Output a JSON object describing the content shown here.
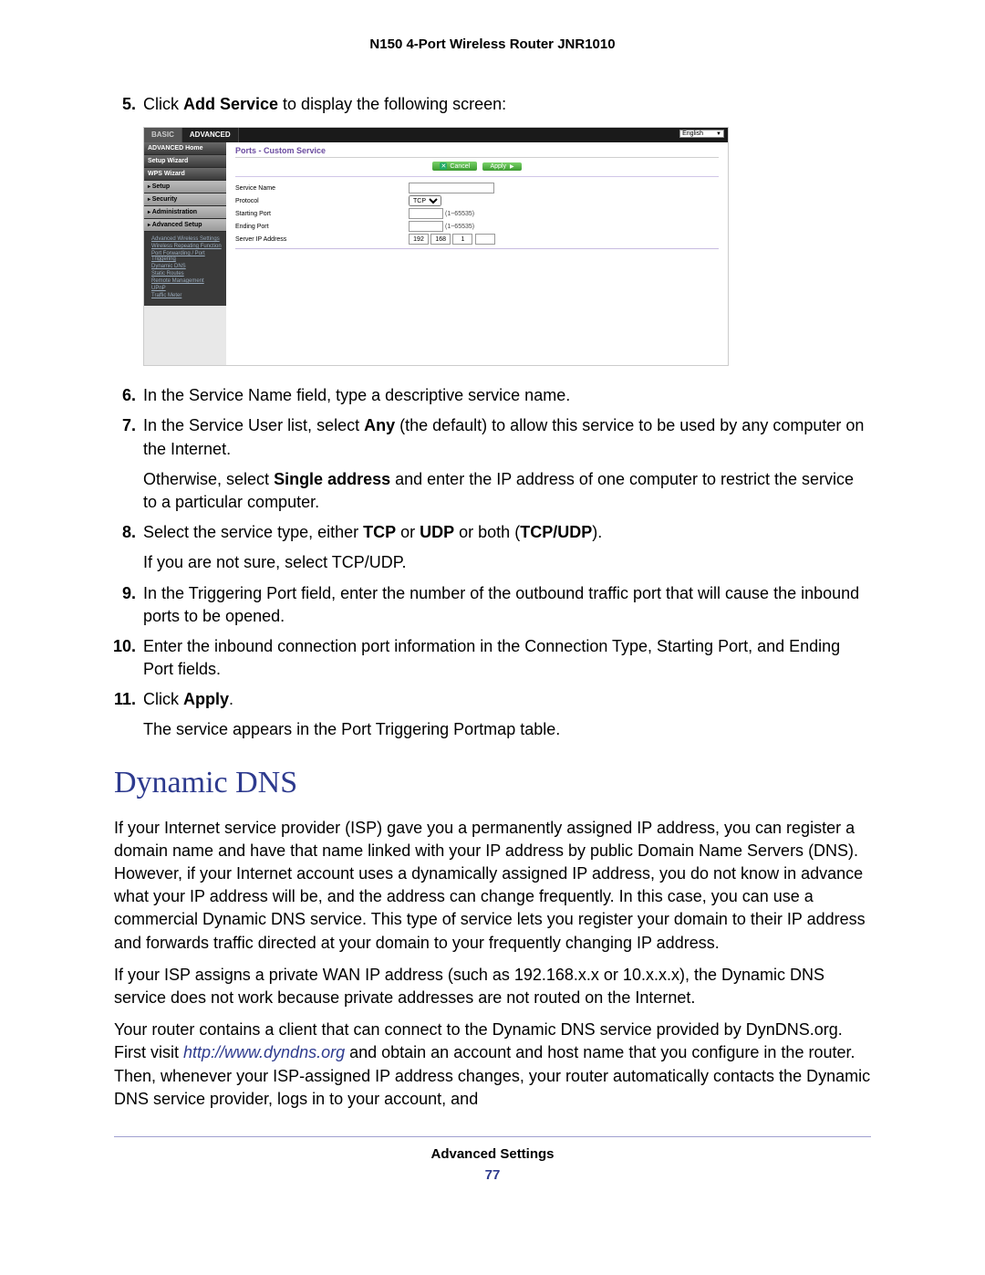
{
  "header": {
    "title": "N150 4-Port Wireless Router JNR1010"
  },
  "steps": {
    "s5": {
      "num": "5.",
      "pre": "Click ",
      "bold": "Add Service",
      "post": " to display the following screen:"
    },
    "s6": {
      "num": "6.",
      "text": "In the Service Name field, type a descriptive service name."
    },
    "s7": {
      "num": "7.",
      "pre": "In the Service User list, select ",
      "bold": "Any",
      "post": " (the default) to allow this service to be used by any computer on the Internet."
    },
    "s7b": {
      "pre": "Otherwise, select ",
      "bold": "Single address",
      "post": " and enter the IP address of one computer to restrict the service to a particular computer."
    },
    "s8": {
      "num": "8.",
      "pre": "Select the service type, either ",
      "b1": "TCP",
      "mid1": " or ",
      "b2": "UDP",
      "mid2": " or both (",
      "b3": "TCP/UDP",
      "post": ")."
    },
    "s8b": "If you are not sure, select TCP/UDP.",
    "s9": {
      "num": "9.",
      "text": "In the Triggering Port field, enter the number of the outbound traffic port that will cause the inbound ports to be opened."
    },
    "s10": {
      "num": "10.",
      "text": "Enter the inbound connection port information in the Connection Type, Starting Port, and Ending Port fields."
    },
    "s11": {
      "num": "11.",
      "pre": "Click ",
      "bold": "Apply",
      "post": "."
    },
    "s11b": "The service appears in the Port Triggering Portmap table."
  },
  "router": {
    "tabs": {
      "basic": "BASIC",
      "advanced": "ADVANCED"
    },
    "lang": "English",
    "sidebar": {
      "home": "ADVANCED Home",
      "setup_wizard": "Setup Wizard",
      "wps_wizard": "WPS Wizard",
      "setup": "Setup",
      "security": "Security",
      "administration": "Administration",
      "advanced_setup": "Advanced Setup",
      "sub": {
        "aws": "Advanced Wireless Settings",
        "wrf": "Wireless Repeating Function",
        "pft": "Port Forwarding / Port Triggering",
        "ddns": "Dynamic DNS",
        "sr": "Static Routes",
        "rm": "Remote Management",
        "upnp": "UPnP",
        "tm": "Traffic Meter"
      }
    },
    "panel": {
      "title": "Ports - Custom Service",
      "cancel": "Cancel",
      "apply": "Apply",
      "fields": {
        "service_name": "Service Name",
        "protocol": "Protocol",
        "protocol_val": "TCP",
        "starting_port": "Starting Port",
        "ending_port": "Ending Port",
        "port_hint": "(1~65535)",
        "server_ip": "Server IP Address",
        "ip1": "192",
        "ip2": "168",
        "ip3": "1",
        "ip4": ""
      }
    }
  },
  "ddns": {
    "heading": "Dynamic DNS",
    "p1": "If your Internet service provider (ISP) gave you a permanently assigned IP address, you can register a domain name and have that name linked with your IP address by public Domain Name Servers (DNS). However, if your Internet account uses a dynamically assigned IP address, you do not know in advance what your IP address will be, and the address can change frequently. In this case, you can use a commercial Dynamic DNS service. This type of service lets you register your domain to their IP address and forwards traffic directed at your domain to your frequently changing IP address.",
    "p2": "If your ISP assigns a private WAN IP address (such as 192.168.x.x or 10.x.x.x), the Dynamic DNS service does not work because private addresses are not routed on the Internet.",
    "p3a": "Your router contains a client that can connect to the Dynamic DNS service provided by DynDNS.org. First visit ",
    "p3link": "http://www.dyndns.org",
    "p3b": " and obtain an account and host name that you configure in the router. Then, whenever your ISP-assigned IP address changes, your router automatically contacts the Dynamic DNS service provider, logs in to your account, and"
  },
  "footer": {
    "section": "Advanced Settings",
    "page": "77"
  }
}
